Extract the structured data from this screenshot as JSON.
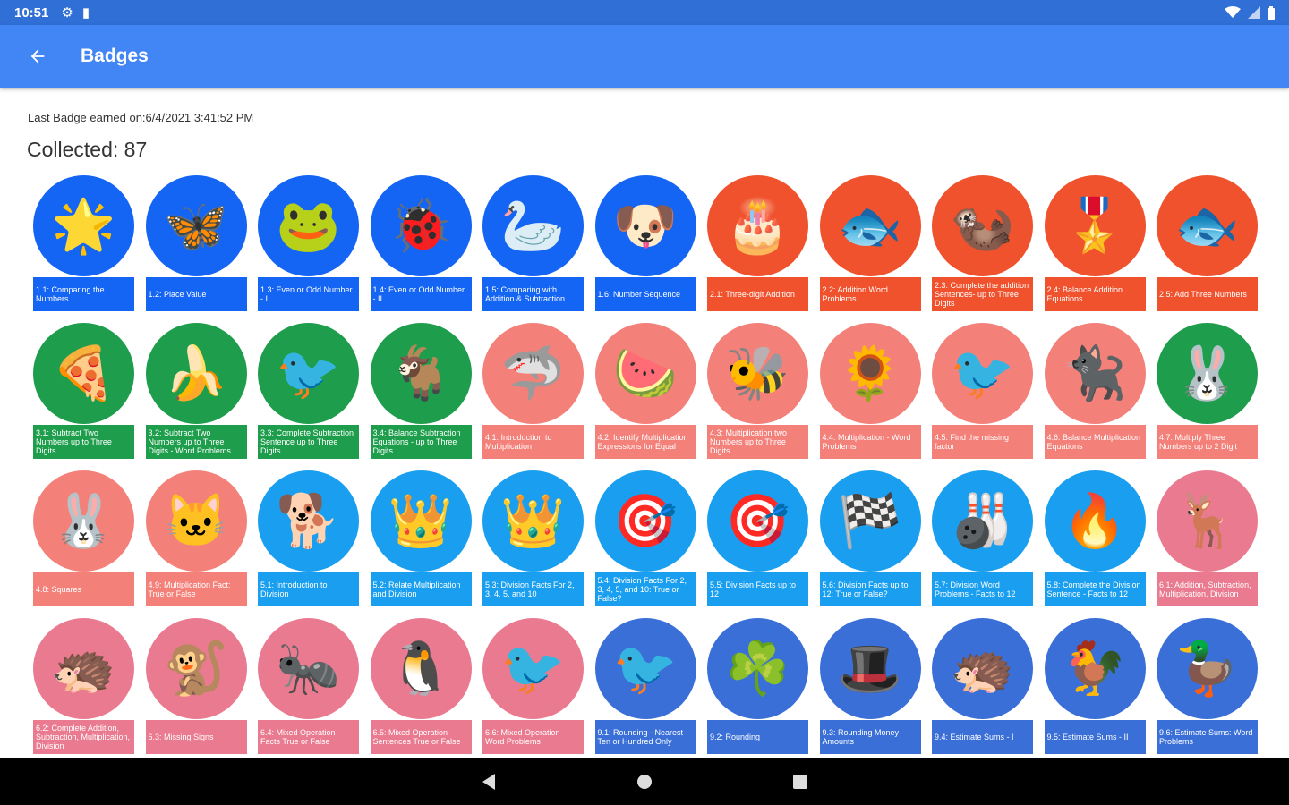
{
  "status_bar": {
    "time": "10:51",
    "icons": [
      "settings-icon",
      "sd-card-icon",
      "wifi-icon",
      "signal-icon",
      "battery-icon"
    ]
  },
  "app_bar": {
    "title": "Badges",
    "back_icon": "arrow-back-icon"
  },
  "summary": {
    "last_badge": "Last Badge earned on:6/4/2021 3:41:52 PM",
    "collected": "Collected: 87"
  },
  "colors": {
    "status": "#2f6fd6",
    "appbar": "#4285f4",
    "blue": "#1565f5",
    "red": "#f0522e",
    "green": "#1e9e4c",
    "salmon": "#f4807a",
    "skyblue": "#1a9ff0",
    "pink": "#ea7a8f",
    "royal": "#3a6fd8"
  },
  "badges": [
    {
      "icon": "🌟",
      "circle": "#1565f5",
      "band": "#1565f5",
      "label": "1.1: Comparing the Numbers"
    },
    {
      "icon": "🦋",
      "circle": "#1565f5",
      "band": "#1565f5",
      "label": "1.2: Place Value"
    },
    {
      "icon": "🐸",
      "circle": "#1565f5",
      "band": "#1565f5",
      "label": "1.3: Even or Odd Number - I"
    },
    {
      "icon": "🐞",
      "circle": "#1565f5",
      "band": "#1565f5",
      "label": "1.4: Even or Odd Number - II"
    },
    {
      "icon": "🦢",
      "circle": "#1565f5",
      "band": "#1565f5",
      "label": "1.5: Comparing with Addition & Subtraction"
    },
    {
      "icon": "🐶",
      "circle": "#1565f5",
      "band": "#1565f5",
      "label": "1.6: Number Sequence"
    },
    {
      "icon": "🎂",
      "circle": "#f0522e",
      "band": "#f0522e",
      "label": "2.1: Three-digit Addition"
    },
    {
      "icon": "🐟",
      "circle": "#f0522e",
      "band": "#f0522e",
      "label": "2.2: Addition Word Problems"
    },
    {
      "icon": "🦦",
      "circle": "#f0522e",
      "band": "#f0522e",
      "label": "2.3: Complete the addition Sentences- up to Three Digits"
    },
    {
      "icon": "🎖️",
      "circle": "#f0522e",
      "band": "#f0522e",
      "label": "2.4: Balance Addition Equations"
    },
    {
      "icon": "🐟",
      "circle": "#f0522e",
      "band": "#f0522e",
      "label": "2.5: Add Three Numbers"
    },
    {
      "icon": "🍕",
      "circle": "#1e9e4c",
      "band": "#1e9e4c",
      "label": "3.1: Subtract Two Numbers up to Three Digits"
    },
    {
      "icon": "🍌",
      "circle": "#1e9e4c",
      "band": "#1e9e4c",
      "label": "3.2: Subtract Two Numbers up to Three Digits - Word Problems"
    },
    {
      "icon": "🐦",
      "circle": "#1e9e4c",
      "band": "#1e9e4c",
      "label": "3.3: Complete Subtraction Sentence up to Three Digits"
    },
    {
      "icon": "🐐",
      "circle": "#1e9e4c",
      "band": "#1e9e4c",
      "label": "3.4: Balance Subtraction Equations - up to Three Digits"
    },
    {
      "icon": "🦈",
      "circle": "#f4807a",
      "band": "#f4807a",
      "label": "4.1: Introduction to Multiplication"
    },
    {
      "icon": "🍉",
      "circle": "#f4807a",
      "band": "#f4807a",
      "label": "4.2: Identify Multiplication Expressions for Equal"
    },
    {
      "icon": "🐝",
      "circle": "#f4807a",
      "band": "#f4807a",
      "label": "4.3: Multiplication two Numbers up to Three Digits"
    },
    {
      "icon": "🌻",
      "circle": "#f4807a",
      "band": "#f4807a",
      "label": "4.4: Multiplication - Word Problems"
    },
    {
      "icon": "🐦",
      "circle": "#f4807a",
      "band": "#f4807a",
      "label": "4.5: Find the missing factor"
    },
    {
      "icon": "🐈‍⬛",
      "circle": "#f4807a",
      "band": "#f4807a",
      "label": "4.6: Balance Multiplication Equations"
    },
    {
      "icon": "🐰",
      "circle": "#1e9e4c",
      "band": "#f4807a",
      "label": "4.7: Multiply Three Numbers up to 2 Digit"
    },
    {
      "icon": "🐰",
      "circle": "#f4807a",
      "band": "#f4807a",
      "label": "4.8: Squares"
    },
    {
      "icon": "🐱",
      "circle": "#f4807a",
      "band": "#f4807a",
      "label": "4.9: Multiplication Fact: True or False"
    },
    {
      "icon": "🐕",
      "circle": "#1a9ff0",
      "band": "#1a9ff0",
      "label": "5.1: Introduction to Division"
    },
    {
      "icon": "👑",
      "circle": "#1a9ff0",
      "band": "#1a9ff0",
      "label": "5.2: Relate Multiplication and Division"
    },
    {
      "icon": "👑",
      "circle": "#1a9ff0",
      "band": "#1a9ff0",
      "label": "5.3: Division Facts For 2, 3, 4, 5, and 10"
    },
    {
      "icon": "🎯",
      "circle": "#1a9ff0",
      "band": "#1a9ff0",
      "label": "5.4: Division Facts For 2, 3, 4, 5, and 10: True or False?"
    },
    {
      "icon": "🎯",
      "circle": "#1a9ff0",
      "band": "#1a9ff0",
      "label": "5.5: Division Facts up to 12"
    },
    {
      "icon": "🏁",
      "circle": "#1a9ff0",
      "band": "#1a9ff0",
      "label": "5.6: Division Facts up to 12: True or False?"
    },
    {
      "icon": "🎳",
      "circle": "#1a9ff0",
      "band": "#1a9ff0",
      "label": "5.7: Division Word Problems - Facts to 12"
    },
    {
      "icon": "🔥",
      "circle": "#1a9ff0",
      "band": "#1a9ff0",
      "label": "5.8: Complete the Division Sentence - Facts to 12"
    },
    {
      "icon": "🦌",
      "circle": "#ea7a8f",
      "band": "#ea7a8f",
      "label": "6.1: Addition, Subtraction, Multiplication, Division"
    },
    {
      "icon": "🦔",
      "circle": "#ea7a8f",
      "band": "#ea7a8f",
      "label": "6.2: Complete Addition, Subtraction, Multiplication, Division"
    },
    {
      "icon": "🐒",
      "circle": "#ea7a8f",
      "band": "#ea7a8f",
      "label": "6.3: Missing Signs"
    },
    {
      "icon": "🐜",
      "circle": "#ea7a8f",
      "band": "#ea7a8f",
      "label": "6.4: Mixed Operation Facts True or False"
    },
    {
      "icon": "🐧",
      "circle": "#ea7a8f",
      "band": "#ea7a8f",
      "label": "6.5: Mixed Operation Sentences True or False"
    },
    {
      "icon": "🐦",
      "circle": "#ea7a8f",
      "band": "#ea7a8f",
      "label": "6.6: Mixed Operation Word Problems"
    },
    {
      "icon": "🐦",
      "circle": "#3a6fd8",
      "band": "#3a6fd8",
      "label": "9.1: Rounding - Nearest Ten or Hundred Only"
    },
    {
      "icon": "☘️",
      "circle": "#3a6fd8",
      "band": "#3a6fd8",
      "label": "9.2: Rounding"
    },
    {
      "icon": "🎩",
      "circle": "#3a6fd8",
      "band": "#3a6fd8",
      "label": "9.3: Rounding Money Amounts"
    },
    {
      "icon": "🦔",
      "circle": "#3a6fd8",
      "band": "#3a6fd8",
      "label": "9.4: Estimate Sums - I"
    },
    {
      "icon": "🐓",
      "circle": "#3a6fd8",
      "band": "#3a6fd8",
      "label": "9.5: Estimate Sums - II"
    },
    {
      "icon": "🦆",
      "circle": "#3a6fd8",
      "band": "#3a6fd8",
      "label": "9.6: Estimate Sums: Word Problems"
    }
  ],
  "nav_bar": {
    "icons": [
      "nav-back-icon",
      "nav-home-icon",
      "nav-recents-icon"
    ]
  }
}
